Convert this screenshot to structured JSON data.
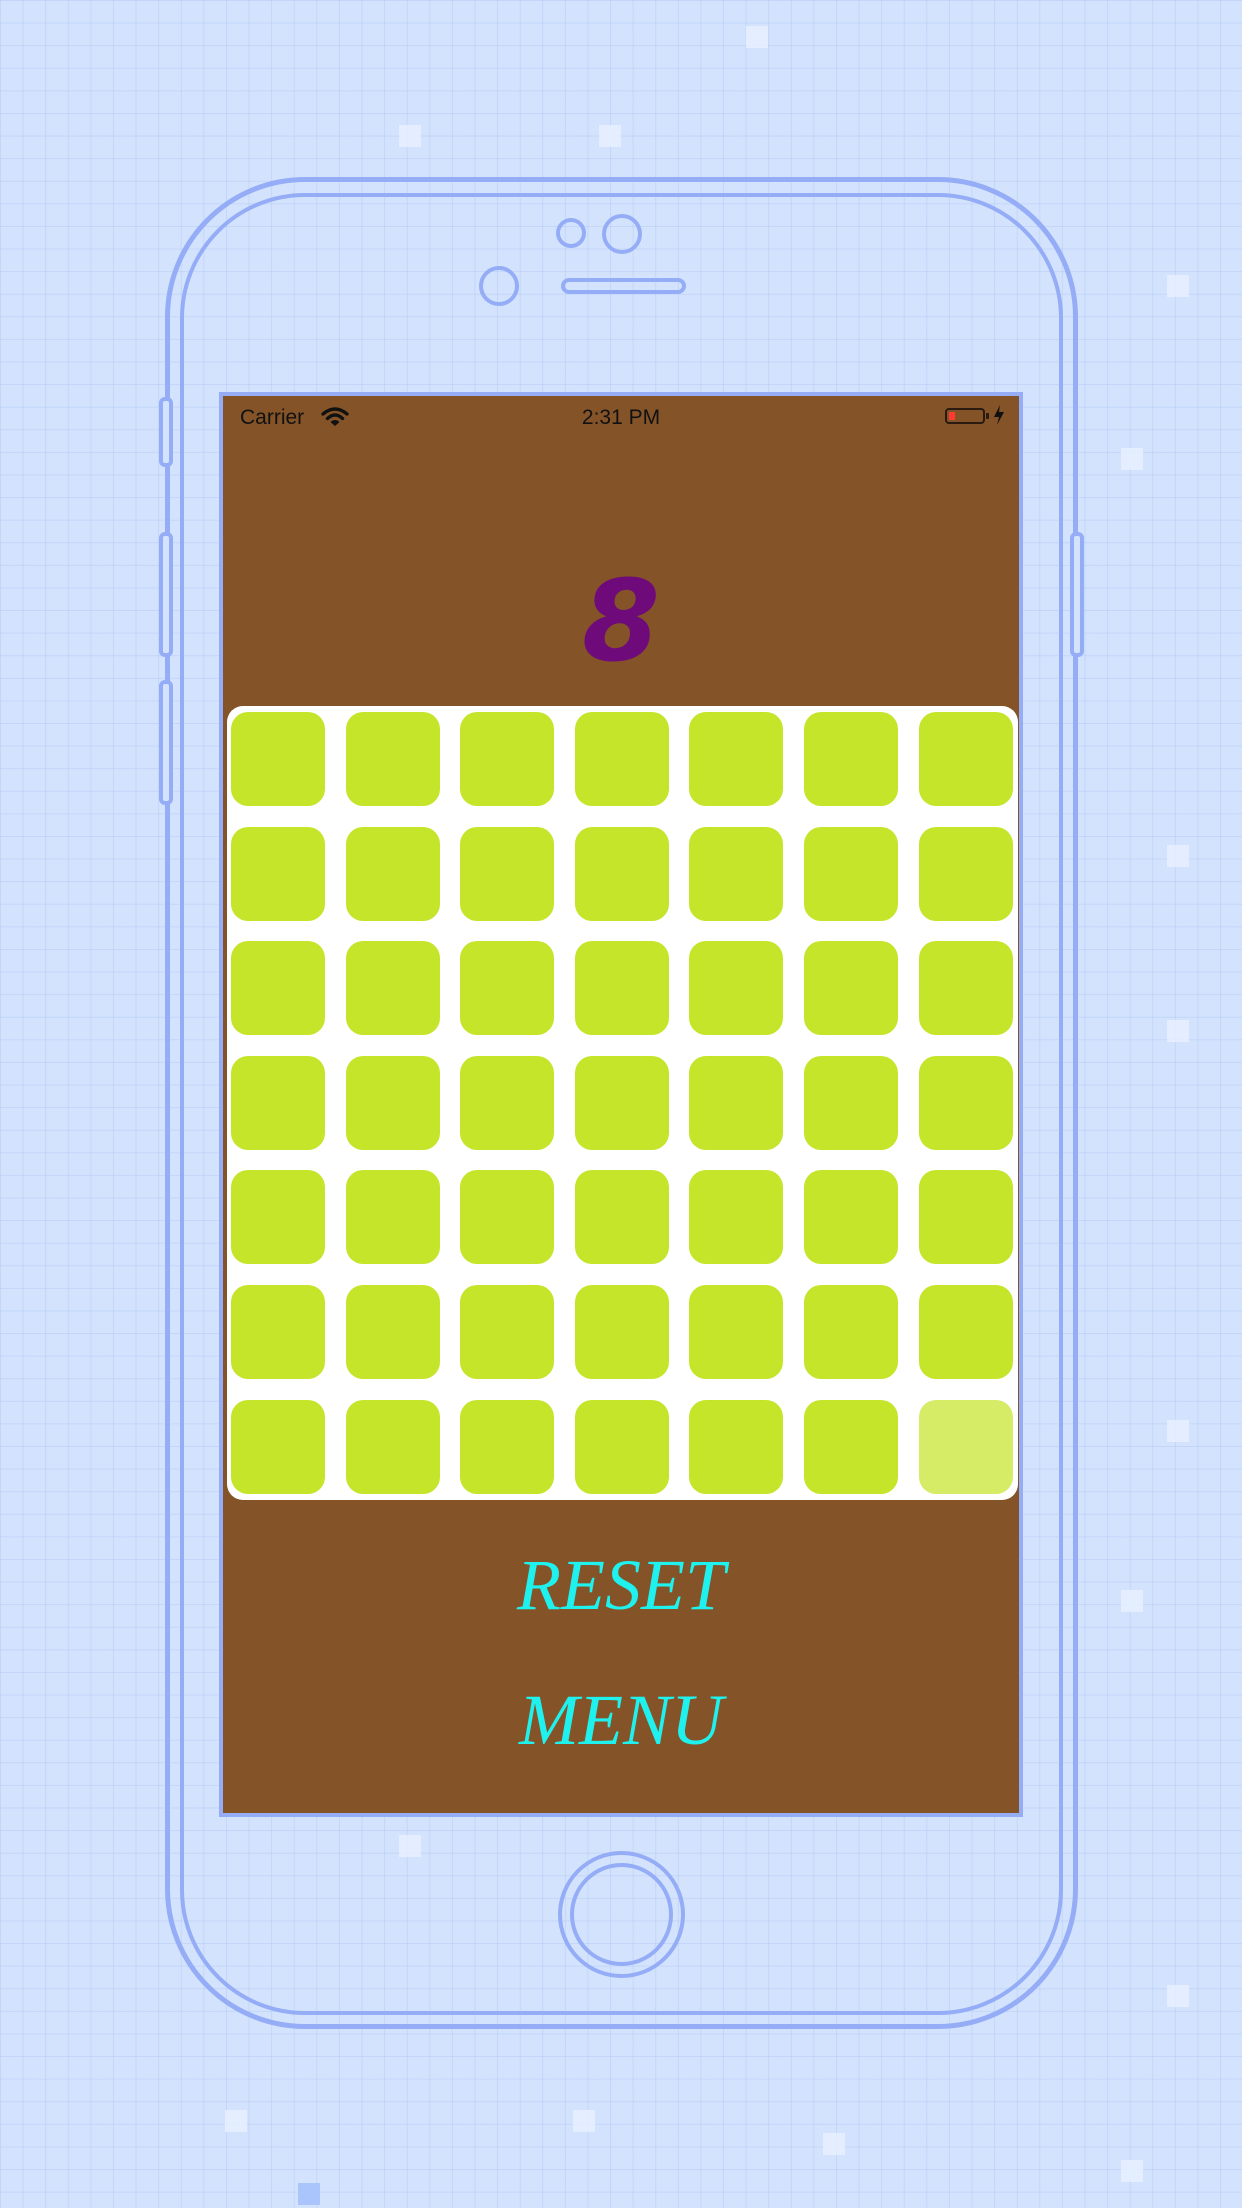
{
  "status_bar": {
    "carrier": "Carrier",
    "time": "2:31 PM",
    "wifi_icon": "wifi-icon",
    "battery_icon": "battery-low-icon",
    "charging_icon": "charging-bolt-icon",
    "battery_color": "#ff3b30"
  },
  "game": {
    "score": "8",
    "board": {
      "rows": 7,
      "columns": 7,
      "tile_color": "#c4e52a",
      "dim_tile_color": "#d6ec67",
      "dim_tiles": [
        [
          6,
          6
        ]
      ]
    }
  },
  "actions": {
    "reset_label": "RESET",
    "menu_label": "MENU"
  },
  "colors": {
    "screen_background": "#845428",
    "score_color": "#6e0a79",
    "action_color": "#1ff2ee",
    "board_background": "#ffffff",
    "page_background": "#d4e3fd",
    "device_outline": "#94adf6"
  }
}
